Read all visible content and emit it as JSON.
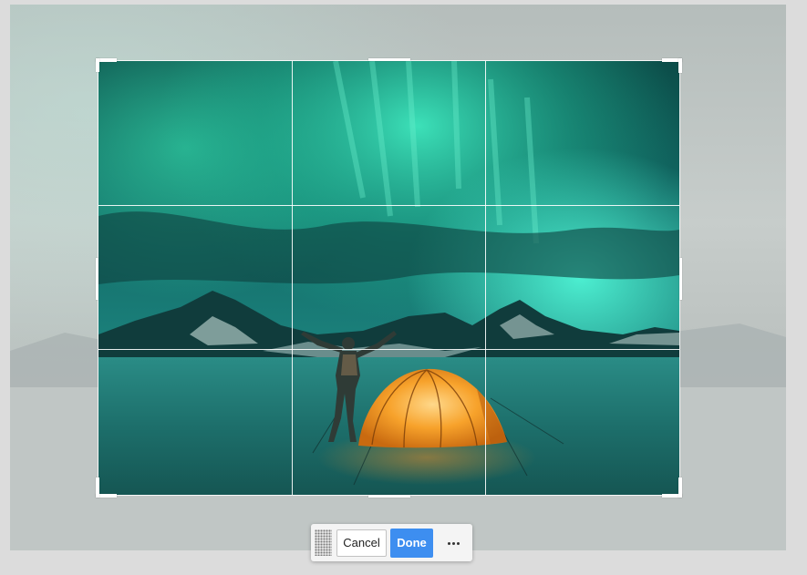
{
  "toolbar": {
    "cancel_label": "Cancel",
    "done_label": "Done",
    "drag_handle_icon": "grip-dots-icon",
    "more_icon": "more-horizontal-icon"
  },
  "colors": {
    "accent": "#3d8ef0",
    "aurora": "#27c9a7",
    "tent": "#f39a1e",
    "canvas_background": "#dcdcdc"
  }
}
